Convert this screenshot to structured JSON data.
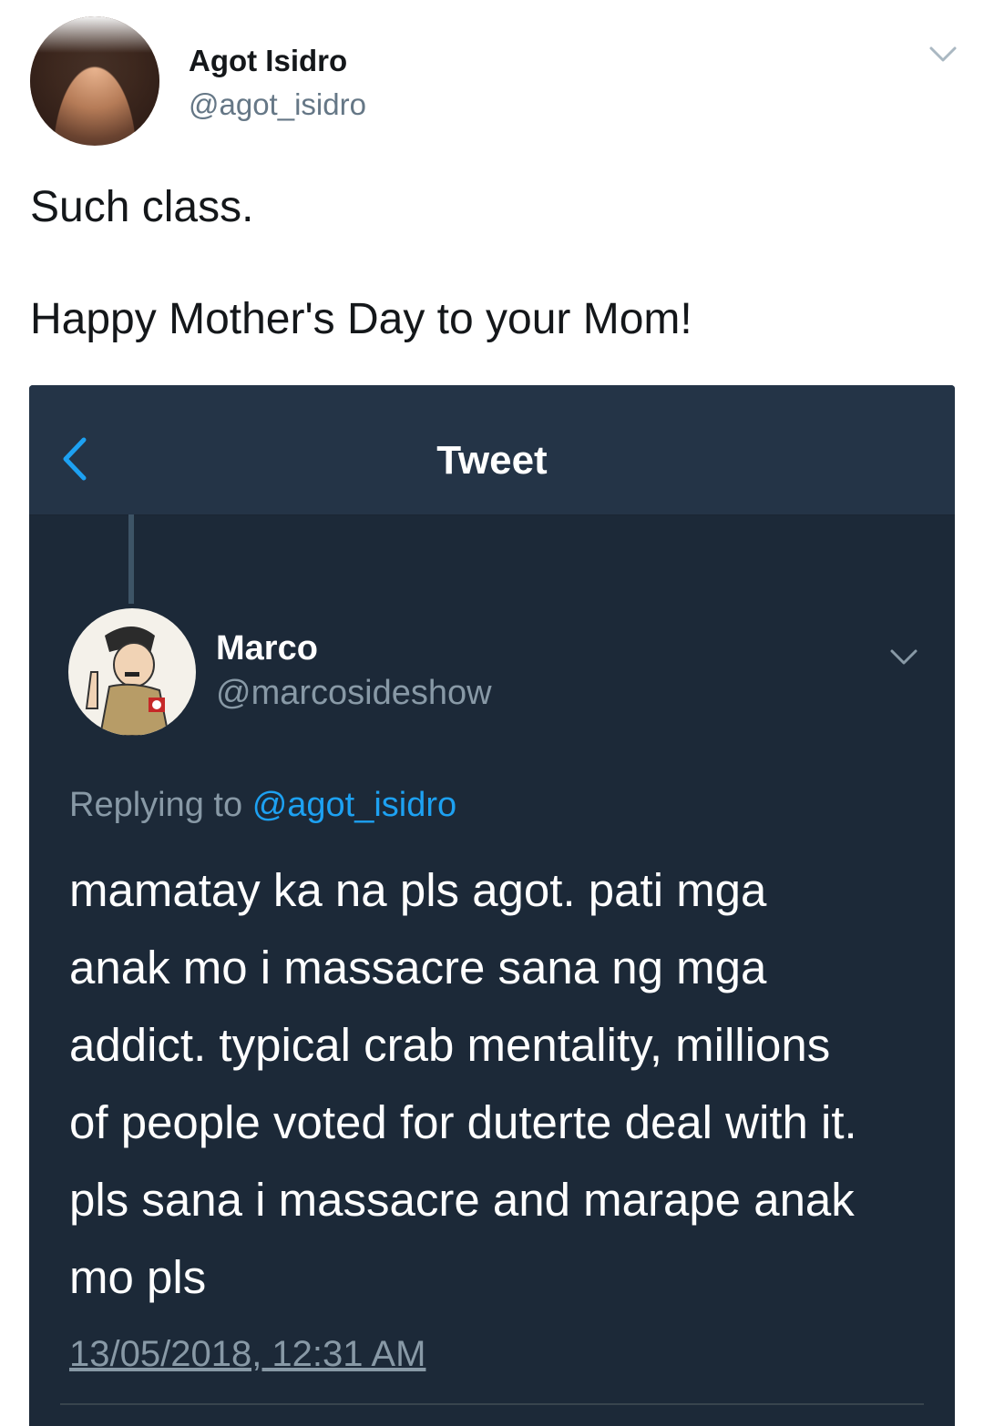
{
  "outer_tweet": {
    "author_name": "Agot Isidro",
    "author_handle": "@agot_isidro",
    "avatar_icon": "profile-photo",
    "text_lines": [
      "Such class.",
      "Happy Mother's Day to your Mom!"
    ]
  },
  "embedded_screenshot": {
    "header": {
      "back_icon": "chevron-left-icon",
      "title": "Tweet"
    },
    "tweet": {
      "author_name": "Marco",
      "author_handle": "@marcosideshow",
      "avatar_icon": "cartoon-caricature",
      "replying_prefix": "Replying to",
      "replying_mention": "@agot_isidro",
      "body_lines": [
        "mamatay ka na pls agot. pati mga",
        "anak mo i massacre sana ng mga",
        "addict. typical crab mentality, millions",
        "of people voted for duterte deal with it.",
        "pls sana i massacre and marape anak",
        "mo pls"
      ],
      "timestamp": "13/05/2018, 12:31 AM"
    }
  },
  "colors": {
    "dark_background": "#1c2938",
    "header_background": "#243447",
    "link_blue": "#1da1f2",
    "muted_gray": "#8899a6"
  }
}
